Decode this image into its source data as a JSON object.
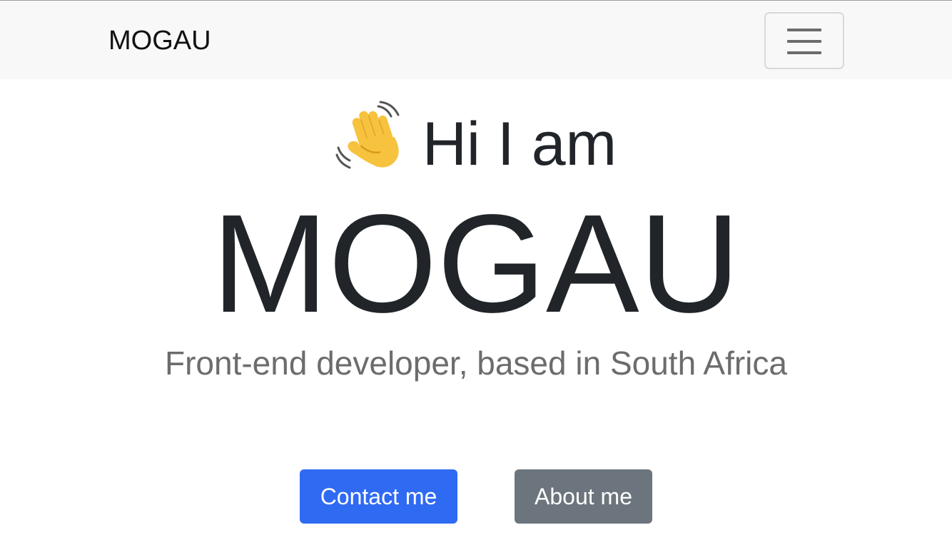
{
  "navbar": {
    "brand": "MOGAU",
    "toggler_icon": "hamburger-menu-icon"
  },
  "hero": {
    "greeting_icon": "waving-hand-emoji",
    "greeting": "Hi I am",
    "name": "MOGAU",
    "subtitle": "Front-end developer, based in South Africa"
  },
  "buttons": {
    "contact_label": "Contact me",
    "about_label": "About me"
  },
  "colors": {
    "primary": "#2f6af2",
    "secondary": "#6c757d",
    "navbar_bg": "#f8f8f8",
    "subtitle": "#6c6c6c"
  }
}
